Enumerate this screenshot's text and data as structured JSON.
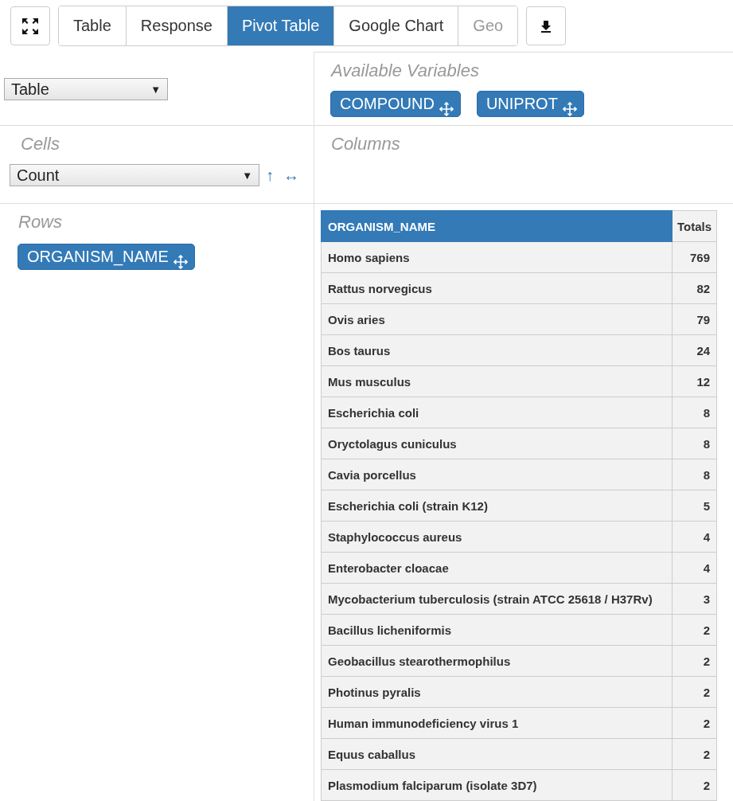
{
  "tabs": [
    {
      "label": "Table",
      "selected": false,
      "disabled": false
    },
    {
      "label": "Response",
      "selected": false,
      "disabled": false
    },
    {
      "label": "Pivot Table",
      "selected": true,
      "disabled": false
    },
    {
      "label": "Google Chart",
      "selected": false,
      "disabled": false
    },
    {
      "label": "Geo",
      "selected": false,
      "disabled": true
    }
  ],
  "renderer": {
    "value": "Table",
    "caret": "▼"
  },
  "available_variables": {
    "label": "Available Variables",
    "chips": [
      "COMPOUND",
      "UNIPROT"
    ]
  },
  "cells": {
    "label": "Cells",
    "aggregator": "Count",
    "aggregator_caret": "▼",
    "row_order": "↑",
    "col_order": "↔"
  },
  "columns": {
    "label": "Columns"
  },
  "rows": {
    "label": "Rows",
    "chips": [
      "ORGANISM_NAME"
    ]
  },
  "table": {
    "header": "ORGANISM_NAME",
    "totals_label": "Totals",
    "rows": [
      {
        "name": "Homo sapiens",
        "total": "769"
      },
      {
        "name": "Rattus norvegicus",
        "total": "82"
      },
      {
        "name": "Ovis aries",
        "total": "79"
      },
      {
        "name": "Bos taurus",
        "total": "24"
      },
      {
        "name": "Mus musculus",
        "total": "12"
      },
      {
        "name": "Escherichia coli",
        "total": "8"
      },
      {
        "name": "Oryctolagus cuniculus",
        "total": "8"
      },
      {
        "name": "Cavia porcellus",
        "total": "8"
      },
      {
        "name": "Escherichia coli (strain K12)",
        "total": "5"
      },
      {
        "name": "Staphylococcus aureus",
        "total": "4"
      },
      {
        "name": "Enterobacter cloacae",
        "total": "4"
      },
      {
        "name": "Mycobacterium tuberculosis (strain ATCC 25618 / H37Rv)",
        "total": "3"
      },
      {
        "name": "Bacillus licheniformis",
        "total": "2"
      },
      {
        "name": "Geobacillus stearothermophilus",
        "total": "2"
      },
      {
        "name": "Photinus pyralis",
        "total": "2"
      },
      {
        "name": "Human immunodeficiency virus 1",
        "total": "2"
      },
      {
        "name": "Equus caballus",
        "total": "2"
      },
      {
        "name": "Plasmodium falciparum (isolate 3D7)",
        "total": "2"
      }
    ]
  }
}
